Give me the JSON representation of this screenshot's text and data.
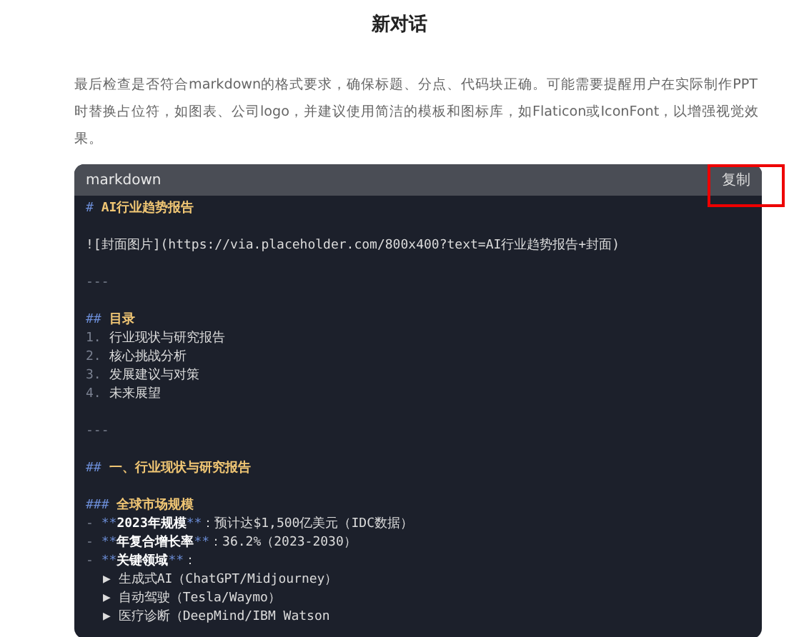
{
  "title": "新对话",
  "paragraph": "最后检查是否符合markdown的格式要求，确保标题、分点、代码块正确。可能需要提醒用户在实际制作PPT时替换占位符，如图表、公司logo，并建议使用简洁的模板和图标库，如Flaticon或IconFont，以增强视觉效果。",
  "code_block": {
    "language": "markdown",
    "copy_button": "复制",
    "copy_highlighted": true,
    "lines": [
      {
        "kind": "heading",
        "marker": "#",
        "text": "AI行业趋势报告"
      },
      {
        "kind": "blank"
      },
      {
        "kind": "text",
        "text": "![封面图片](https://via.placeholder.com/800x400?text=AI行业趋势报告+封面)"
      },
      {
        "kind": "blank"
      },
      {
        "kind": "rule",
        "text": "---"
      },
      {
        "kind": "blank"
      },
      {
        "kind": "heading",
        "marker": "##",
        "text": "目录"
      },
      {
        "kind": "numbered",
        "number": "1.",
        "text": "行业现状与研究报告"
      },
      {
        "kind": "numbered",
        "number": "2.",
        "text": "核心挑战分析"
      },
      {
        "kind": "numbered",
        "number": "3.",
        "text": "发展建议与对策"
      },
      {
        "kind": "numbered",
        "number": "4.",
        "text": "未来展望"
      },
      {
        "kind": "blank"
      },
      {
        "kind": "rule",
        "text": "---"
      },
      {
        "kind": "blank"
      },
      {
        "kind": "heading",
        "marker": "##",
        "text": "一、行业现状与研究报告"
      },
      {
        "kind": "blank"
      },
      {
        "kind": "heading",
        "marker": "###",
        "text": "全球市场规模"
      },
      {
        "kind": "bullet",
        "dash": "-",
        "open": "**",
        "bold": "2023年规模",
        "close": "**",
        "rest": "：预计达$1,500亿美元（IDC数据）"
      },
      {
        "kind": "bullet",
        "dash": "-",
        "open": "**",
        "bold": "年复合增长率",
        "close": "**",
        "rest": "：36.2%（2023-2030）"
      },
      {
        "kind": "bullet",
        "dash": "-",
        "open": "**",
        "bold": "关键领域",
        "close": "**",
        "rest": "："
      },
      {
        "kind": "sub",
        "arrow": "▶",
        "text": "生成式AI（ChatGPT/Midjourney）"
      },
      {
        "kind": "sub",
        "arrow": "▶",
        "text": "自动驾驶（Tesla/Waymo）"
      },
      {
        "kind": "sub",
        "arrow": "▶",
        "text": "医疗诊断（DeepMind/IBM Watson"
      }
    ]
  }
}
